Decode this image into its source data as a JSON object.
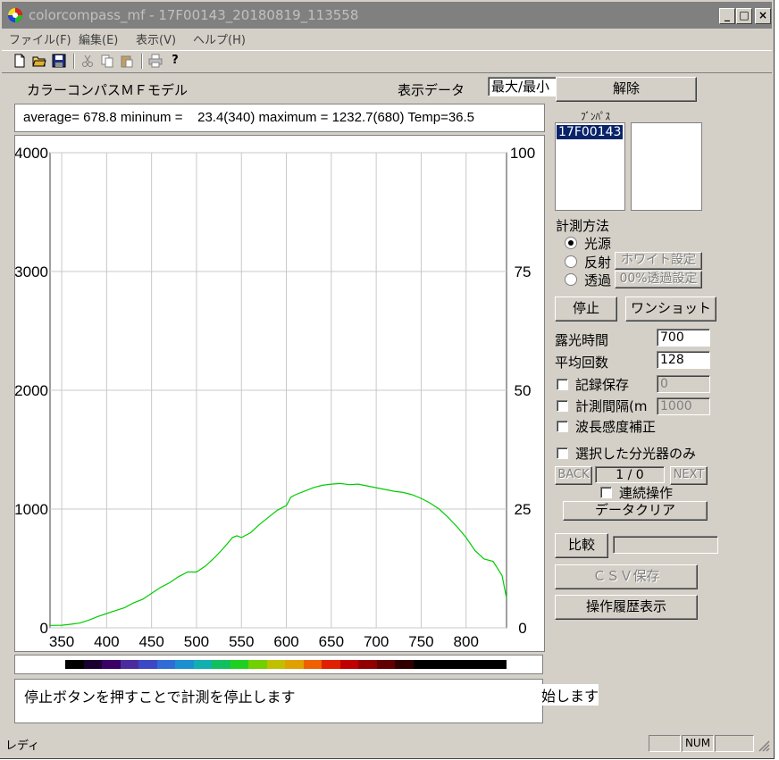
{
  "window": {
    "title": "colorcompass_mf - 17F00143_20180819_113558",
    "min": "_",
    "max": "□",
    "close": "×"
  },
  "menu": [
    "ファイル(F)",
    "編集(E)",
    "表示(V)",
    "ヘルプ(H)"
  ],
  "toolbar": {
    "icons": [
      "new-file-icon",
      "open-folder-icon",
      "save-icon",
      "cut-icon",
      "copy-icon",
      "paste-icon",
      "print-icon",
      "help-icon"
    ]
  },
  "header": {
    "model_label": "カラーコンパスＭＦモデル",
    "display_label": "表示データ",
    "display_value": "最大/最小"
  },
  "stats": {
    "text": "average= 678.8 mininum =    23.4(340) maximum = 1232.7(680) Temp=36.5"
  },
  "chart_data": {
    "type": "line",
    "xlim": [
      337,
      845
    ],
    "ylim": [
      0,
      4000
    ],
    "y2lim": [
      0,
      100
    ],
    "x_ticks": [
      "350",
      "400",
      "450",
      "500",
      "550",
      "600",
      "650",
      "700",
      "750",
      "800"
    ],
    "y_ticks": [
      "0",
      "1000",
      "2000",
      "3000",
      "4000"
    ],
    "y2_ticks": [
      "0",
      "25",
      "50",
      "75",
      "100"
    ],
    "grid": true,
    "series_color": "#00cc00",
    "x": [
      337,
      350,
      360,
      370,
      380,
      390,
      400,
      410,
      420,
      430,
      440,
      450,
      460,
      470,
      480,
      490,
      500,
      510,
      520,
      530,
      540,
      545,
      550,
      560,
      570,
      580,
      590,
      600,
      605,
      610,
      620,
      630,
      640,
      650,
      660,
      670,
      680,
      690,
      700,
      710,
      720,
      730,
      740,
      750,
      760,
      770,
      780,
      790,
      800,
      810,
      820,
      830,
      840,
      845
    ],
    "y": [
      20,
      22,
      30,
      40,
      65,
      95,
      120,
      145,
      170,
      210,
      240,
      290,
      340,
      380,
      430,
      470,
      470,
      520,
      590,
      670,
      760,
      775,
      760,
      800,
      870,
      930,
      990,
      1030,
      1100,
      1120,
      1150,
      1180,
      1200,
      1210,
      1215,
      1205,
      1210,
      1195,
      1180,
      1165,
      1150,
      1140,
      1120,
      1090,
      1050,
      1000,
      930,
      850,
      760,
      650,
      580,
      560,
      440,
      250
    ]
  },
  "spectrum_bar": {
    "colors": [
      "#000000",
      "#1a0030",
      "#3a0066",
      "#4b2c9e",
      "#3b47c4",
      "#2f6cd6",
      "#1a90d0",
      "#10b0b0",
      "#10c060",
      "#20d020",
      "#70d000",
      "#c0c000",
      "#e0a000",
      "#f06000",
      "#e02000",
      "#c00000",
      "#900000",
      "#600000",
      "#300000",
      "#000000",
      "#000000",
      "#000000",
      "#000000",
      "#000000"
    ]
  },
  "status_message": {
    "text": "停止ボタンを押すことで計測を停止します",
    "overflow": "始します"
  },
  "right": {
    "release_button": "解除",
    "list_title": "ﾌﾞﾝﾊﾟｽ",
    "list_item": "17F00143",
    "method_label": "計測方法",
    "radios": [
      "光源",
      "反射",
      "透過"
    ],
    "white_button": "ホワイト設定",
    "transmit_button": "00%透過設定",
    "stop_button": "停止",
    "oneshot_button": "ワンショット",
    "exposure_label": "露光時間",
    "exposure_value": "700",
    "average_label": "平均回数",
    "average_value": "128",
    "record_label": "記録保存",
    "record_value": "0",
    "interval_label": "計測間隔(m",
    "interval_value": "1000",
    "wavelength_label": "波長感度補正",
    "selected_label": "選択した分光器のみ",
    "back_button": "BACK",
    "page_value": "1 / 0",
    "next_button": "NEXT",
    "continuous_label": "連続操作",
    "clear_button": "データクリア",
    "compare_button": "比較",
    "csv_button": "ＣＳＶ保存",
    "history_button": "操作履歴表示"
  },
  "statusbar": {
    "ready": "レディ",
    "num": "NUM"
  }
}
